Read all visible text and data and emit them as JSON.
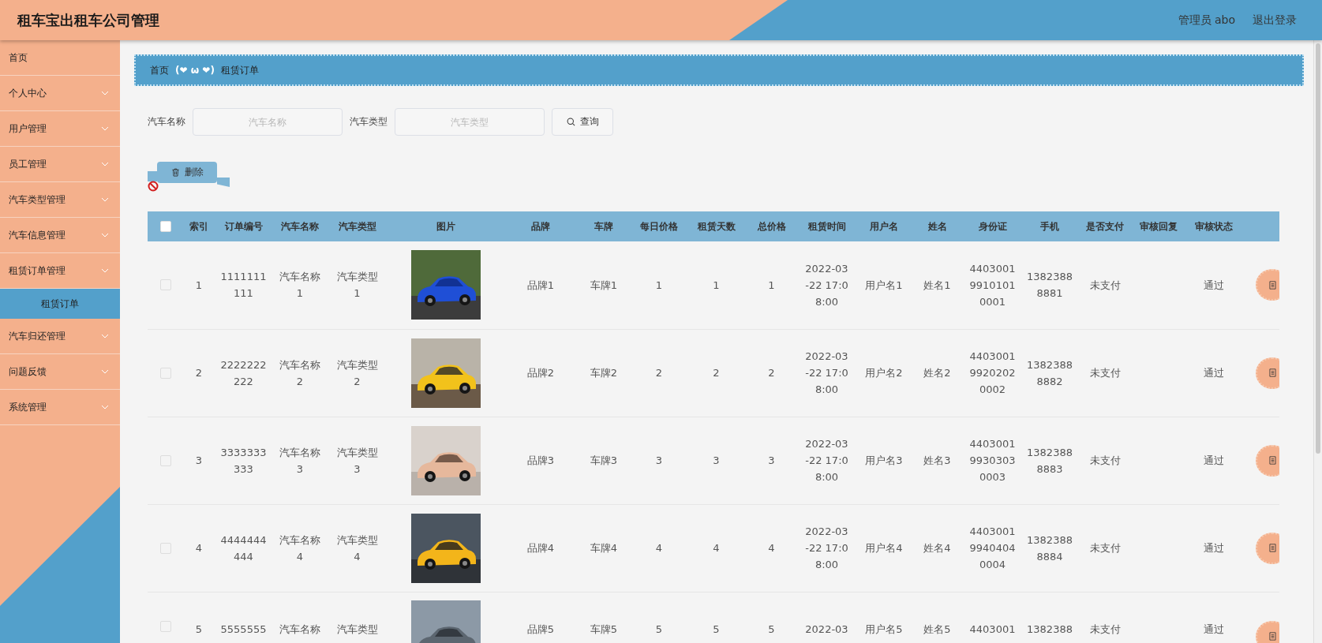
{
  "header": {
    "title": "租车宝出租车公司管理",
    "user": "管理员 abo",
    "logout": "退出登录"
  },
  "sidebar": {
    "items": [
      {
        "label": "首页",
        "kind": "link"
      },
      {
        "label": "个人中心",
        "kind": "menu"
      },
      {
        "label": "用户管理",
        "kind": "menu"
      },
      {
        "label": "员工管理",
        "kind": "menu"
      },
      {
        "label": "汽车类型管理",
        "kind": "menu"
      },
      {
        "label": "汽车信息管理",
        "kind": "menu"
      },
      {
        "label": "租赁订单管理",
        "kind": "menu",
        "children": [
          {
            "label": "租赁订单",
            "selected": true
          }
        ]
      },
      {
        "label": "汽车归还管理",
        "kind": "menu"
      },
      {
        "label": "问题反馈",
        "kind": "menu"
      },
      {
        "label": "系统管理",
        "kind": "menu"
      }
    ]
  },
  "breadcrumb": {
    "home": "首页",
    "separator": "(❤ ω ❤)",
    "current": "租赁订单"
  },
  "search": {
    "fields": [
      {
        "label": "汽车名称",
        "placeholder": "汽车名称"
      },
      {
        "label": "汽车类型",
        "placeholder": "汽车类型"
      }
    ],
    "button": "查询"
  },
  "delete_button": "删除",
  "table": {
    "select_all": {
      "checked": false
    },
    "columns": [
      "索引",
      "订单编号",
      "汽车名称",
      "汽车类型",
      "图片",
      "品牌",
      "车牌",
      "每日价格",
      "租赁天数",
      "总价格",
      "租赁时间",
      "用户名",
      "姓名",
      "身份证",
      "手机",
      "是否支付",
      "审核回复",
      "审核状态"
    ],
    "rows": [
      {
        "checked": false,
        "cells": [
          "1",
          "1111111\n111",
          "汽车名称\n1",
          "汽车类型\n1",
          {
            "kind": "picture"
          },
          "品牌1",
          "车牌1",
          "1",
          "1",
          "1",
          "2022-03\n-22 17:0\n8:00",
          "用户名1",
          "姓名1",
          "4403001\n9910101\n0001",
          "1382388\n8881",
          "未支付",
          "",
          "通过"
        ]
      },
      {
        "checked": false,
        "cells": [
          "2",
          "2222222\n222",
          "汽车名称\n2",
          "汽车类型\n2",
          {
            "kind": "picture"
          },
          "品牌2",
          "车牌2",
          "2",
          "2",
          "2",
          "2022-03\n-22 17:0\n8:00",
          "用户名2",
          "姓名2",
          "4403001\n9920202\n0002",
          "1382388\n8882",
          "未支付",
          "",
          "通过"
        ]
      },
      {
        "checked": false,
        "cells": [
          "3",
          "3333333\n333",
          "汽车名称\n3",
          "汽车类型\n3",
          {
            "kind": "picture"
          },
          "品牌3",
          "车牌3",
          "3",
          "3",
          "3",
          "2022-03\n-22 17:0\n8:00",
          "用户名3",
          "姓名3",
          "4403001\n9930303\n0003",
          "1382388\n8883",
          "未支付",
          "",
          "通过"
        ]
      },
      {
        "checked": false,
        "cells": [
          "4",
          "4444444\n444",
          "汽车名称\n4",
          "汽车类型\n4",
          {
            "kind": "picture"
          },
          "品牌4",
          "车牌4",
          "4",
          "4",
          "4",
          "2022-03\n-22 17:0\n8:00",
          "用户名4",
          "姓名4",
          "4403001\n9940404\n0004",
          "1382388\n8884",
          "未支付",
          "",
          "通过"
        ]
      },
      {
        "checked": false,
        "cells": [
          "5",
          "5555555",
          "汽车名称",
          "汽车类型",
          {
            "kind": "picture"
          },
          "品牌5",
          "车牌5",
          "5",
          "5",
          "5",
          "2022-03",
          "用户名5",
          "姓名5",
          "4403001",
          "1382388",
          "未支付",
          "",
          "通过"
        ]
      }
    ]
  }
}
